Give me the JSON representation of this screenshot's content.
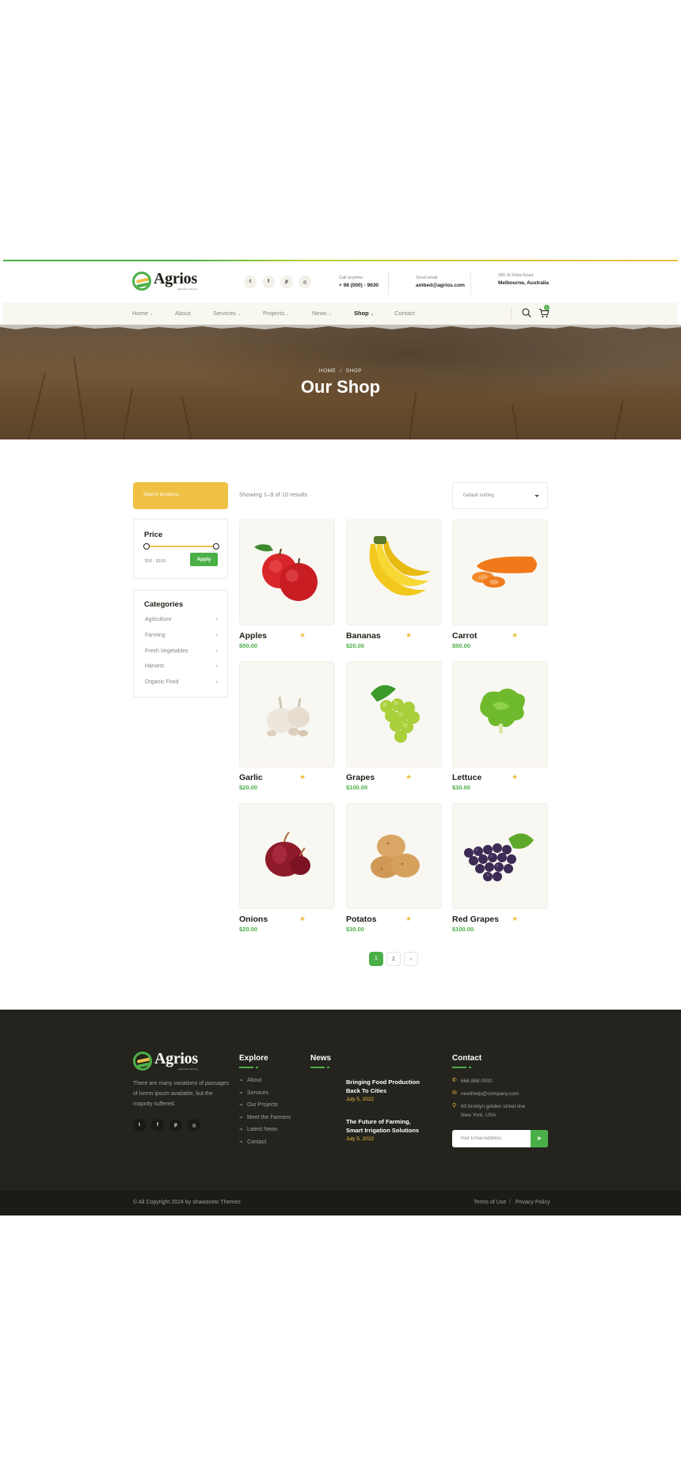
{
  "brand": {
    "name": "Agrios",
    "tagline": "agriculture farming"
  },
  "colors": {
    "primary": "#4baf47",
    "accent": "#eec044",
    "dark": "#24231d",
    "text": "#1f1e17",
    "muted": "#878680"
  },
  "header": {
    "socials": [
      {
        "icon": "twitter-icon",
        "glyph": "t"
      },
      {
        "icon": "facebook-icon",
        "glyph": "f"
      },
      {
        "icon": "pinterest-icon",
        "glyph": "p"
      },
      {
        "icon": "instagram-icon",
        "glyph": "◎"
      }
    ],
    "call": {
      "label": "Call anytime",
      "value": "+ 98 (000) - 9630"
    },
    "email": {
      "label": "Send email",
      "value": "ambed@agrios.com"
    },
    "address": {
      "label": "380 St Kilda Road",
      "value": "Melbourne, Australia"
    }
  },
  "nav": {
    "items": [
      {
        "label": "Home",
        "dropdown": true
      },
      {
        "label": "About",
        "dropdown": false
      },
      {
        "label": "Services",
        "dropdown": true
      },
      {
        "label": "Projects",
        "dropdown": true
      },
      {
        "label": "News",
        "dropdown": true
      },
      {
        "label": "Shop",
        "dropdown": true,
        "active": true
      },
      {
        "label": "Contact",
        "dropdown": false
      }
    ],
    "cart_count": "0"
  },
  "hero": {
    "breadcrumb_home": "HOME",
    "breadcrumb_current": "SHOP",
    "title": "Our Shop"
  },
  "sidebar": {
    "search_placeholder": "Search products...",
    "price": {
      "title": "Price",
      "range": "$20 - $100",
      "apply_label": "Apply"
    },
    "categories": {
      "title": "Categories",
      "items": [
        "Agriculture",
        "Farming",
        "Fresh Vegetables",
        "Harvest",
        "Organic Food"
      ]
    }
  },
  "toolbar": {
    "showing": "Showing 1–9 of 10 results",
    "sort_selected": "Default sorting"
  },
  "products": [
    {
      "name": "Apples",
      "price": "$50.00",
      "rating": "★",
      "icon": "apples-image"
    },
    {
      "name": "Bananas",
      "price": "$20.00",
      "rating": "★",
      "icon": "bananas-image"
    },
    {
      "name": "Carrot",
      "price": "$50.00",
      "rating": "★",
      "icon": "carrot-image"
    },
    {
      "name": "Garlic",
      "price": "$20.00",
      "rating": "★",
      "icon": "garlic-image"
    },
    {
      "name": "Grapes",
      "price": "$100.00",
      "rating": "★",
      "icon": "grapes-image"
    },
    {
      "name": "Lettuce",
      "price": "$30.00",
      "rating": "★",
      "icon": "lettuce-image"
    },
    {
      "name": "Onions",
      "price": "$20.00",
      "rating": "★",
      "icon": "onions-image"
    },
    {
      "name": "Potatos",
      "price": "$30.00",
      "rating": "★",
      "icon": "potatos-image"
    },
    {
      "name": "Red Grapes",
      "price": "$100.00",
      "rating": "★",
      "icon": "red-grapes-image"
    }
  ],
  "pagination": {
    "pages": [
      "1",
      "2"
    ],
    "next": "›",
    "current": "1"
  },
  "footer": {
    "about": "There are many variations of passages of lorem ipsum available, but the majority suffered.",
    "explore": {
      "title": "Explore",
      "links": [
        "About",
        "Services",
        "Our Projects",
        "Meet the Farmers",
        "Latest News",
        "Contact"
      ]
    },
    "news": {
      "title": "News",
      "items": [
        {
          "title": "Bringing Food Production Back To Cities",
          "date": "July 5, 2022"
        },
        {
          "title": "The Future of Farming, Smart Irrigation Solutions",
          "date": "July 5, 2022"
        }
      ]
    },
    "contact": {
      "title": "Contact",
      "phone": "666 888 0000",
      "email": "needhelp@company.com",
      "address_line1": "80 broklyn golden street line",
      "address_line2": "New York, USA",
      "newsletter_placeholder": "Your Email Address"
    },
    "copyright": "© All Copyright 2024 by shawonetc Themes",
    "terms": "Terms of Use",
    "privacy": "Privacy Policy"
  }
}
